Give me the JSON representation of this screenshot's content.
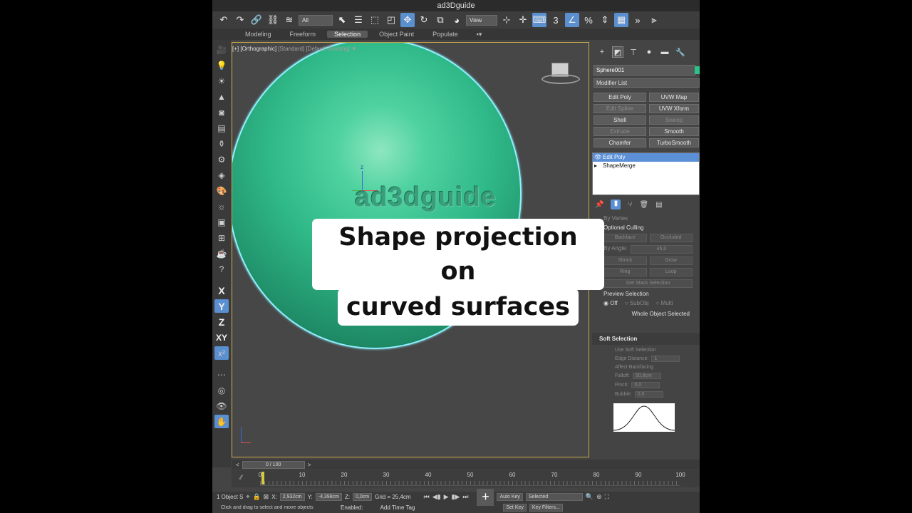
{
  "window": {
    "title": "ad3Dguide"
  },
  "toolbar": {
    "selection_filter": "All",
    "ref_coord": "View",
    "icons": [
      "undo-icon",
      "redo-icon",
      "link-icon",
      "unlink-icon",
      "bind-spacewarp-icon",
      "select-icon",
      "select-by-name-icon",
      "rect-region-icon",
      "window-crossing-icon",
      "move-icon",
      "rotate-icon",
      "scale-icon",
      "place-icon",
      "ref-coord-icon",
      "pivot-icon",
      "select-manipulate-icon",
      "snaps-icon",
      "angle-snap-icon",
      "percent-snap-icon",
      "spinner-snap-icon",
      "named-selection-icon",
      "more-icon"
    ]
  },
  "ribbon": {
    "tabs": [
      "Modeling",
      "Freeform",
      "Selection",
      "Object Paint",
      "Populate"
    ],
    "active": "Selection"
  },
  "left_tools": [
    "X",
    "Y",
    "Z",
    "XY"
  ],
  "viewport": {
    "label_plus": "[+]",
    "label_view": "[Orthographic]",
    "label_standard": "[Standard]",
    "label_shading": "[Default Shading]",
    "watermark": "ad3dguide",
    "pivot_z": "z"
  },
  "caption": {
    "line1": "Shape projection on",
    "line2": "curved surfaces"
  },
  "command_panel": {
    "object_name": "Sphere001",
    "modifier_list": "Modifier List",
    "modifier_buttons": [
      {
        "label": "Edit Poly",
        "enabled": true
      },
      {
        "label": "UVW Map",
        "enabled": true
      },
      {
        "label": "Edit Spline",
        "enabled": false
      },
      {
        "label": "UVW Xform",
        "enabled": true
      },
      {
        "label": "Shell",
        "enabled": true
      },
      {
        "label": "Sweep",
        "enabled": false
      },
      {
        "label": "Extrude",
        "enabled": false
      },
      {
        "label": "Smooth",
        "enabled": true
      },
      {
        "label": "Chamfer",
        "enabled": true
      },
      {
        "label": "TurboSmooth",
        "enabled": true
      }
    ],
    "stack": [
      {
        "label": "Edit Poly",
        "selected": true
      },
      {
        "label": "ShapeMerge",
        "selected": false
      }
    ],
    "by_vertex": "By Vertex",
    "optional_culling": "Optional Culling",
    "backface": "Backface",
    "occluded": "Occluded",
    "by_angle": "By Angle:",
    "by_angle_value": "45,0",
    "shrink": "Shrink",
    "grow": "Grow",
    "ring": "Ring",
    "loop": "Loop",
    "get_stack_selection": "Get Stack Selection",
    "preview_selection": "Preview Selection",
    "preview_options": [
      "Off",
      "SubObj",
      "Multi"
    ],
    "whole_object": "Whole Object Selected",
    "soft_selection": "Soft Selection",
    "use_soft_selection": "Use Soft Selection",
    "edge_distance": "Edge Distance:",
    "edge_distance_value": "1",
    "affect_backfacing": "Affect Backfacing",
    "falloff": "Falloff:",
    "falloff_value": "50,8cm",
    "pinch": "Pinch:",
    "pinch_value": "0,0",
    "bubble": "Bubble:",
    "bubble_value": "0,0"
  },
  "timeline": {
    "frame": "0 / 100",
    "ticks": [
      "0",
      "10",
      "20",
      "30",
      "40",
      "50",
      "60",
      "70",
      "80",
      "90",
      "100"
    ],
    "tick_values": [
      0,
      10,
      20,
      30,
      40,
      50,
      60,
      70,
      80,
      90,
      100
    ]
  },
  "status": {
    "objects": "1 Object S",
    "x_label": "X:",
    "x_value": "2,932cm",
    "y_label": "Y:",
    "y_value": "-4,398cm",
    "z_label": "Z:",
    "z_value": "0,0cm",
    "grid": "Grid = 25,4cm",
    "auto_key": "Auto Key",
    "key_mode": "Selected",
    "set_key": "Set Key",
    "key_filters": "Key Filters...",
    "message": "Click and drag to select and move objects",
    "enabled": "Enabled:",
    "add_time_tag": "Add Time Tag"
  }
}
